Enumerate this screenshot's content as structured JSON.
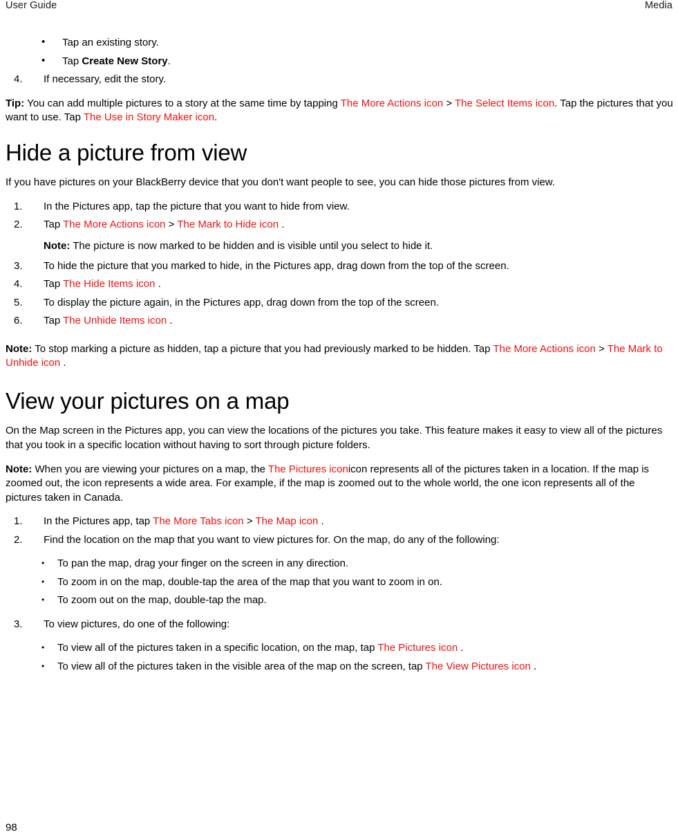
{
  "header": {
    "left": "User Guide",
    "right": "Media"
  },
  "footer": {
    "page_number": "98"
  },
  "colors": {
    "icon_reference": "#ee1111",
    "text": "#000000",
    "background": "#ffffff"
  },
  "top_block": {
    "bullets": [
      {
        "text_before": "Tap an existing story.",
        "bold": "",
        "text_after": ""
      },
      {
        "text_before": "Tap ",
        "bold": "Create New Story",
        "text_after": "."
      }
    ],
    "step": {
      "number": "4.",
      "text": "If necessary, edit the story."
    },
    "tip": {
      "label": "Tip:",
      "part1": "You can add multiple pictures to a story at the same time by tapping",
      "icon1": "The More Actions icon",
      "sep1": ">",
      "icon2": "The Select Items icon",
      "part2": ". Tap the pictures that you want to use. Tap",
      "icon3": "The Use in Story Maker icon",
      "part3": "."
    }
  },
  "section_hide": {
    "title": "Hide a picture from view",
    "intro": "If you have pictures on your BlackBerry device that you don't want people to see, you can hide those pictures from view.",
    "steps": [
      {
        "number": "1.",
        "text": "In the Pictures app, tap the picture that you want to hide from view."
      },
      {
        "number": "2.",
        "prefix": "Tap",
        "icon1": "The More Actions icon",
        "sep": ">",
        "icon2": "The Mark to Hide icon",
        "suffix": "."
      },
      {
        "number": "3.",
        "text": "To hide the picture that you marked to hide, in the Pictures app, drag down from the top of the screen."
      },
      {
        "number": "4.",
        "prefix": "Tap",
        "icon1": "The Hide Items icon",
        "suffix": "."
      },
      {
        "number": "5.",
        "text": "To display the picture again, in the Pictures app, drag down from the top of the screen."
      },
      {
        "number": "6.",
        "prefix": "Tap",
        "icon1": "The Unhide Items icon",
        "suffix": "."
      }
    ],
    "inline_note": {
      "label": "Note:",
      "text": "The picture is now marked to be hidden and is visible until you select to hide it."
    },
    "closing_note": {
      "label": "Note:",
      "part1": "To stop marking a picture as hidden, tap a picture that you had previously marked to be hidden. Tap",
      "icon1": "The More Actions icon",
      "sep": ">",
      "icon2": "The Mark to Unhide icon",
      "part2": "."
    }
  },
  "section_map": {
    "title": "View your pictures on a map",
    "intro": "On the Map screen in the Pictures app, you can view the locations of the pictures you take. This feature makes it easy to view all of the pictures that you took in a specific location without having to sort through picture folders.",
    "note": {
      "label": "Note:",
      "part1": "When you are viewing your pictures on a map, the",
      "icon1": "The Pictures icon",
      "part2": "icon represents all of the pictures taken in a location. If the map is zoomed out, the icon represents a wide area. For example, if the map is zoomed out to the whole world, the one icon represents all of the pictures taken in Canada."
    },
    "steps": [
      {
        "number": "1.",
        "prefix": "In the Pictures app, tap",
        "icon1": "The More Tabs icon",
        "sep": ">",
        "icon2": "The Map icon",
        "suffix": "."
      },
      {
        "number": "2.",
        "text": "Find the location on the map that you want to view pictures for. On the map, do any of the following:"
      },
      {
        "number": "3.",
        "text": "To view pictures, do one of the following:"
      }
    ],
    "map_bullets": [
      "To pan the map, drag your finger on the screen in any direction.",
      "To zoom in on the map, double-tap the area of the map that you want to zoom in on.",
      "To zoom out on the map, double-tap the map."
    ],
    "view_bullets": [
      {
        "prefix": "To view all of the pictures taken in a specific location, on the map, tap",
        "icon": "The Pictures icon",
        "suffix": "."
      },
      {
        "prefix": "To view all of the pictures taken in the visible area of the map on the screen, tap",
        "icon": "The View Pictures icon",
        "suffix": "."
      }
    ]
  }
}
